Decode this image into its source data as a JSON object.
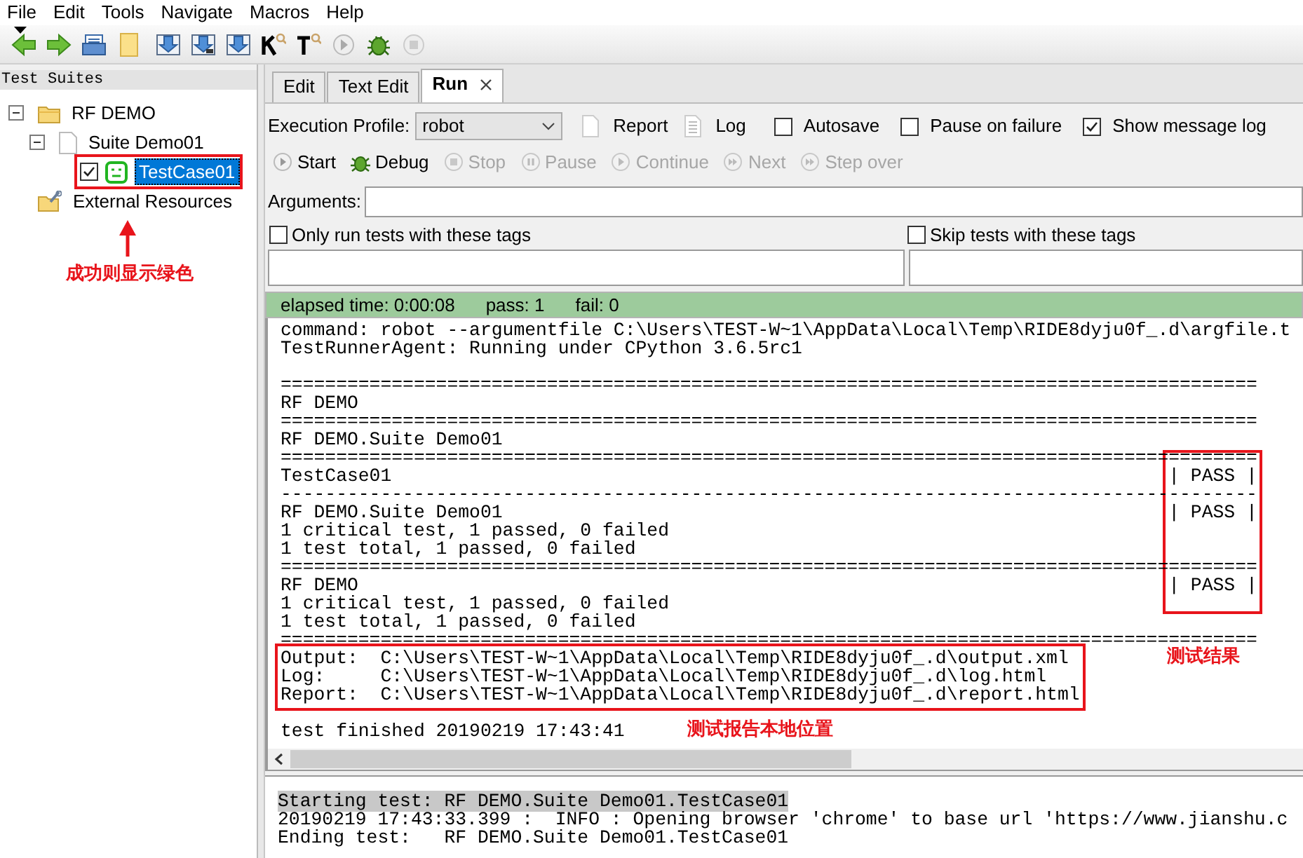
{
  "menu": [
    "File",
    "Edit",
    "Tools",
    "Navigate",
    "Macros",
    "Help"
  ],
  "tree": {
    "header": "Test Suites",
    "items": [
      {
        "label": "RF DEMO",
        "kind": "folder",
        "expanded": true,
        "selected": false,
        "children": [
          {
            "label": "Suite Demo01",
            "kind": "suite",
            "expanded": true,
            "selected": false,
            "children": [
              {
                "label": "TestCase01",
                "kind": "test",
                "checked": true,
                "selected": true,
                "passed": true
              }
            ]
          }
        ]
      },
      {
        "label": "External Resources",
        "kind": "resources",
        "selected": false
      }
    ]
  },
  "tabs": [
    {
      "label": "Edit",
      "selected": false
    },
    {
      "label": "Text Edit",
      "selected": false
    },
    {
      "label": "Run",
      "selected": true
    }
  ],
  "run": {
    "profile_label": "Execution Profile:",
    "profile": "robot",
    "links": [
      {
        "label": "Report",
        "kind": "report"
      },
      {
        "label": "Log",
        "kind": "log"
      }
    ],
    "options": [
      {
        "label": "Autosave",
        "checked": false
      },
      {
        "label": "Pause on failure",
        "checked": false
      },
      {
        "label": "Show message log",
        "checked": true
      }
    ],
    "buttons": [
      {
        "label": "Start",
        "kind": "start",
        "disabled": false
      },
      {
        "label": "Debug",
        "kind": "debug",
        "disabled": false
      },
      {
        "label": "Stop",
        "kind": "stop",
        "disabled": true
      },
      {
        "label": "Pause",
        "kind": "pause",
        "disabled": true
      },
      {
        "label": "Continue",
        "kind": "continue",
        "disabled": true
      },
      {
        "label": "Next",
        "kind": "next",
        "disabled": true
      },
      {
        "label": "Step over",
        "kind": "step",
        "disabled": true
      }
    ],
    "arguments_label": "Arguments:",
    "tag_filters": [
      {
        "label": "Only run tests with these tags",
        "checked": false
      },
      {
        "label": "Skip tests with these tags",
        "checked": false
      }
    ]
  },
  "status_bar": {
    "passed": true,
    "elapsed": "elapsed time: 0:00:08",
    "pass": "pass: 1",
    "fail": "fail: 0"
  },
  "console": {
    "lines": [
      {
        "text": "command: robot --argumentfile C:\\Users\\TEST-W~1\\AppData\\Local\\Temp\\RIDE8dyju0f_.d\\argfile.t"
      },
      {
        "text": "TestRunnerAgent: Running under CPython 3.6.5rc1"
      },
      {
        "kind": "blank"
      },
      {
        "text": "========================================================================================"
      },
      {
        "text": "RF DEMO"
      },
      {
        "text": "========================================================================================"
      },
      {
        "text": "RF DEMO.Suite Demo01"
      },
      {
        "text": "========================================================================================"
      },
      {
        "text": "TestCase01",
        "status": "| PASS |"
      },
      {
        "text": "----------------------------------------------------------------------------------------"
      },
      {
        "text": "RF DEMO.Suite Demo01",
        "status": "| PASS |"
      },
      {
        "text": "1 critical test, 1 passed, 0 failed"
      },
      {
        "text": "1 test total, 1 passed, 0 failed"
      },
      {
        "text": "========================================================================================"
      },
      {
        "text": "RF DEMO",
        "status": "| PASS |"
      },
      {
        "text": "1 critical test, 1 passed, 0 failed"
      },
      {
        "text": "1 test total, 1 passed, 0 failed"
      },
      {
        "text": "========================================================================================"
      },
      {
        "text": "Output:  C:\\Users\\TEST-W~1\\AppData\\Local\\Temp\\RIDE8dyju0f_.d\\output.xml",
        "kind": "output"
      },
      {
        "text": "Log:     C:\\Users\\TEST-W~1\\AppData\\Local\\Temp\\RIDE8dyju0f_.d\\log.html",
        "kind": "output"
      },
      {
        "text": "Report:  C:\\Users\\TEST-W~1\\AppData\\Local\\Temp\\RIDE8dyju0f_.d\\report.html",
        "kind": "output"
      },
      {
        "kind": "blank"
      },
      {
        "text": "test finished 20190219 17:43:41"
      }
    ]
  },
  "message_log": {
    "lines": [
      {
        "text": "Starting test: RF DEMO.Suite Demo01.TestCase01",
        "selected": true
      },
      {
        "text": "20190219 17:43:33.399 :  INFO : Opening browser 'chrome' to base url 'https://www.jianshu.c",
        "selected": false
      },
      {
        "text": "Ending test:   RF DEMO.Suite Demo01.TestCase01",
        "selected": false
      }
    ]
  },
  "annotations": [
    {
      "text": "成功则显示绿色"
    },
    {
      "text": "测试结果"
    },
    {
      "text": "测试报告本地位置"
    }
  ]
}
